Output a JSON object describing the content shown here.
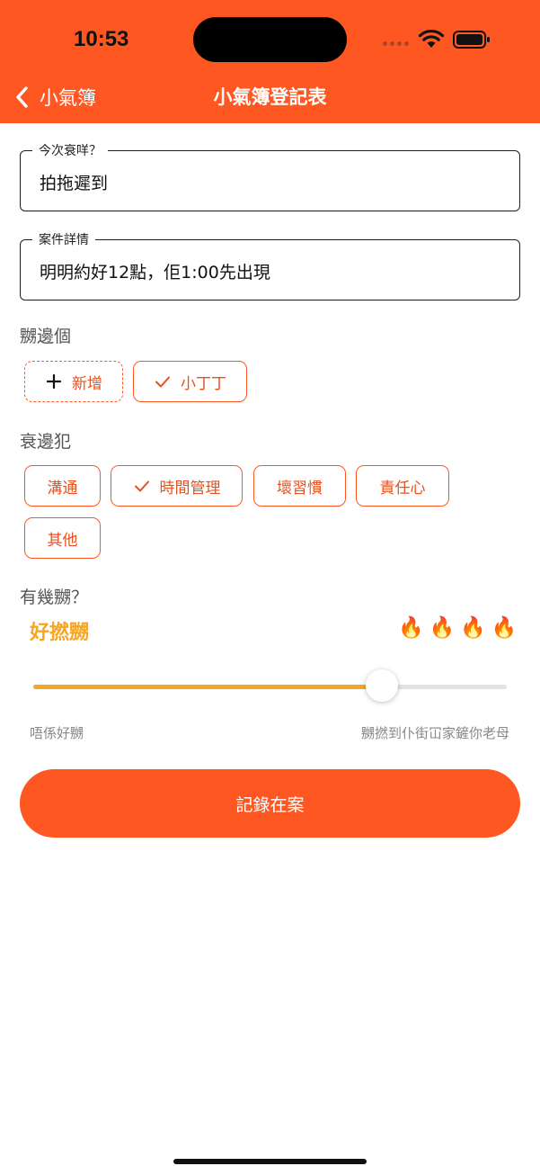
{
  "status_bar": {
    "time": "10:53"
  },
  "nav": {
    "back_label": "小氣簿",
    "title": "小氣簿登記表"
  },
  "form": {
    "title_field": {
      "label": "今次衰咩？",
      "value": "拍拖遲到"
    },
    "details_field": {
      "label": "案件詳情",
      "value": "明明約好12點，佢1:00先出現"
    }
  },
  "people": {
    "label": "嬲邊個",
    "add_label": "新增",
    "chips": [
      {
        "label": "小丁丁",
        "selected": true
      }
    ]
  },
  "offenses": {
    "label": "衰邊犯",
    "chips": [
      {
        "label": "溝通",
        "selected": false
      },
      {
        "label": "時間管理",
        "selected": true
      },
      {
        "label": "壞習慣",
        "selected": false
      },
      {
        "label": "責任心",
        "selected": false
      },
      {
        "label": "其他",
        "selected": false
      }
    ]
  },
  "anger": {
    "label": "有幾嬲？",
    "level_text": "好撚嬲",
    "fire_icon": "🔥",
    "fire_count": 4,
    "value_fraction": 0.737,
    "min_label": "唔係好嬲",
    "max_label": "嬲撚到仆街冚家鏟你老母"
  },
  "submit_label": "記錄在案",
  "colors": {
    "primary": "#ff5722",
    "accent": "#f5a623"
  }
}
